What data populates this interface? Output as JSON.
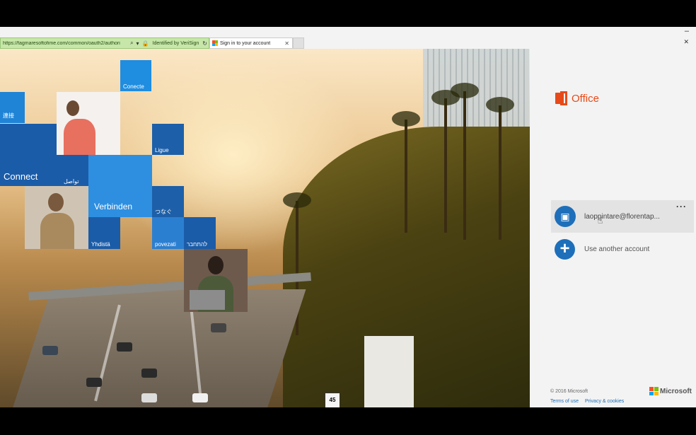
{
  "browser": {
    "url": "https://fagmaresoftofime.com/common/oauth2/authori",
    "verified_label": "Identified by VeriSign",
    "tab_title": "Sign in to your account"
  },
  "tiles": {
    "conecte": "Conecte",
    "chinese": "連接",
    "connect": "Connect",
    "arabic": "تواصل",
    "ligue": "Ligue",
    "verbinden": "Verbinden",
    "japanese": "つなぐ",
    "yhdista": "Yhdistä",
    "povezati": "povezati",
    "hebrew": "להתחבר"
  },
  "sign": {
    "number": "45"
  },
  "office": {
    "name": "Office"
  },
  "account": {
    "email": "laoppintare@florentap...",
    "more": "···"
  },
  "another": {
    "label": "Use another account",
    "plus": "+"
  },
  "footer": {
    "copyright": "© 2016 Microsoft",
    "terms": "Terms of use",
    "privacy": "Privacy & cookies",
    "brand": "Microsoft"
  },
  "colors": {
    "office": "#e64a19",
    "accent": "#1e6fba",
    "ms_red": "#f35325",
    "ms_green": "#81bc06",
    "ms_blue": "#05a6f0",
    "ms_yellow": "#ffba08"
  }
}
